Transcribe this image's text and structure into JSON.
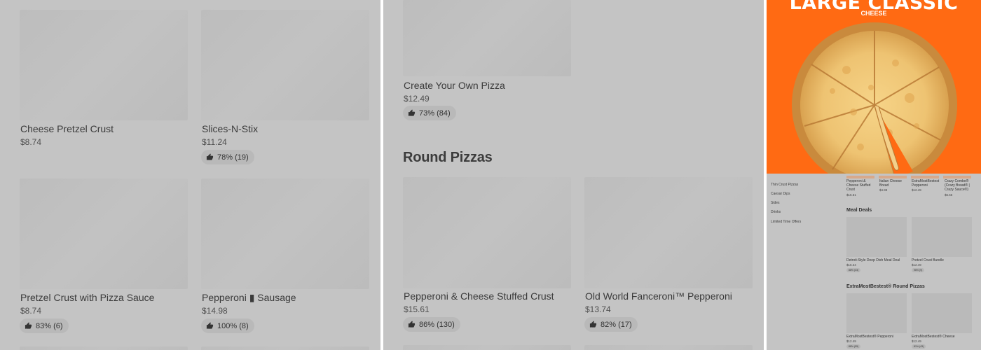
{
  "panel_a": {
    "cards": [
      {
        "name": "Cheese Pretzel Crust",
        "price": "$8.74",
        "rating": ""
      },
      {
        "name": "Slices-N-Stix",
        "price": "$11.24",
        "rating": "78% (19)"
      },
      {
        "name": "Pretzel Crust with Pizza Sauce",
        "price": "$8.74",
        "rating": "83% (6)"
      },
      {
        "name": "Pepperoni ▮ Sausage",
        "price": "$14.98",
        "rating": "100% (8)"
      }
    ]
  },
  "panel_b": {
    "top_card": {
      "name": "Create Your Own Pizza",
      "price": "$12.49",
      "rating": "73% (84)"
    },
    "section_title": "Round Pizzas",
    "cards": [
      {
        "name": "Pepperoni & Cheese Stuffed Crust",
        "price": "$15.61",
        "rating": "86% (130)"
      },
      {
        "name": "Old World Fanceroni™ Pepperoni",
        "price": "$13.74",
        "rating": "82% (17)"
      }
    ]
  },
  "panel_c": {
    "promo": {
      "title": "LARGE CLASSIC",
      "subtitle": "CHEESE",
      "image": "cheese-pizza-image"
    },
    "nav_items": [
      "Thin Crust Pizzas",
      "Caesar Dips",
      "Sides",
      "Drinks",
      "Limited Time Offers"
    ],
    "top_row": [
      {
        "name": "Pepperoni & Cheese Stuffed Crust",
        "price": "$15.61"
      },
      {
        "name": "Italian Cheese Bread",
        "price": "$4.99"
      },
      {
        "name": "ExtraMostBestest Pepperoni",
        "price": "$12.49"
      },
      {
        "name": "Crazy Combo® (Crazy Bread® | Crazy Sauce®)",
        "price": "$6.66"
      }
    ],
    "sections": [
      {
        "title": "Meal Deals",
        "cards": [
          {
            "name": "Detroit-Style Deep Dish Meal Deal",
            "price": "$16.24",
            "rating": "88% (33)"
          },
          {
            "name": "Pretzel Crust Bundle",
            "price": "$12.49",
            "rating": "96% (9)"
          }
        ]
      },
      {
        "title": "ExtraMostBestest® Round Pizzas",
        "cards": [
          {
            "name": "ExtraMostBestest® Pepperoni",
            "price": "$12.49",
            "rating": "88% (55)"
          },
          {
            "name": "ExtraMostBestest® Cheese",
            "price": "$12.49",
            "rating": "81% (43)"
          }
        ]
      }
    ]
  },
  "colors": {
    "promo_bg": "#ff6a13",
    "panel_bg": "#c4c4c4",
    "placeholder": "#bdbdbd"
  },
  "icons": {
    "rating": "thumbs-up-icon"
  }
}
